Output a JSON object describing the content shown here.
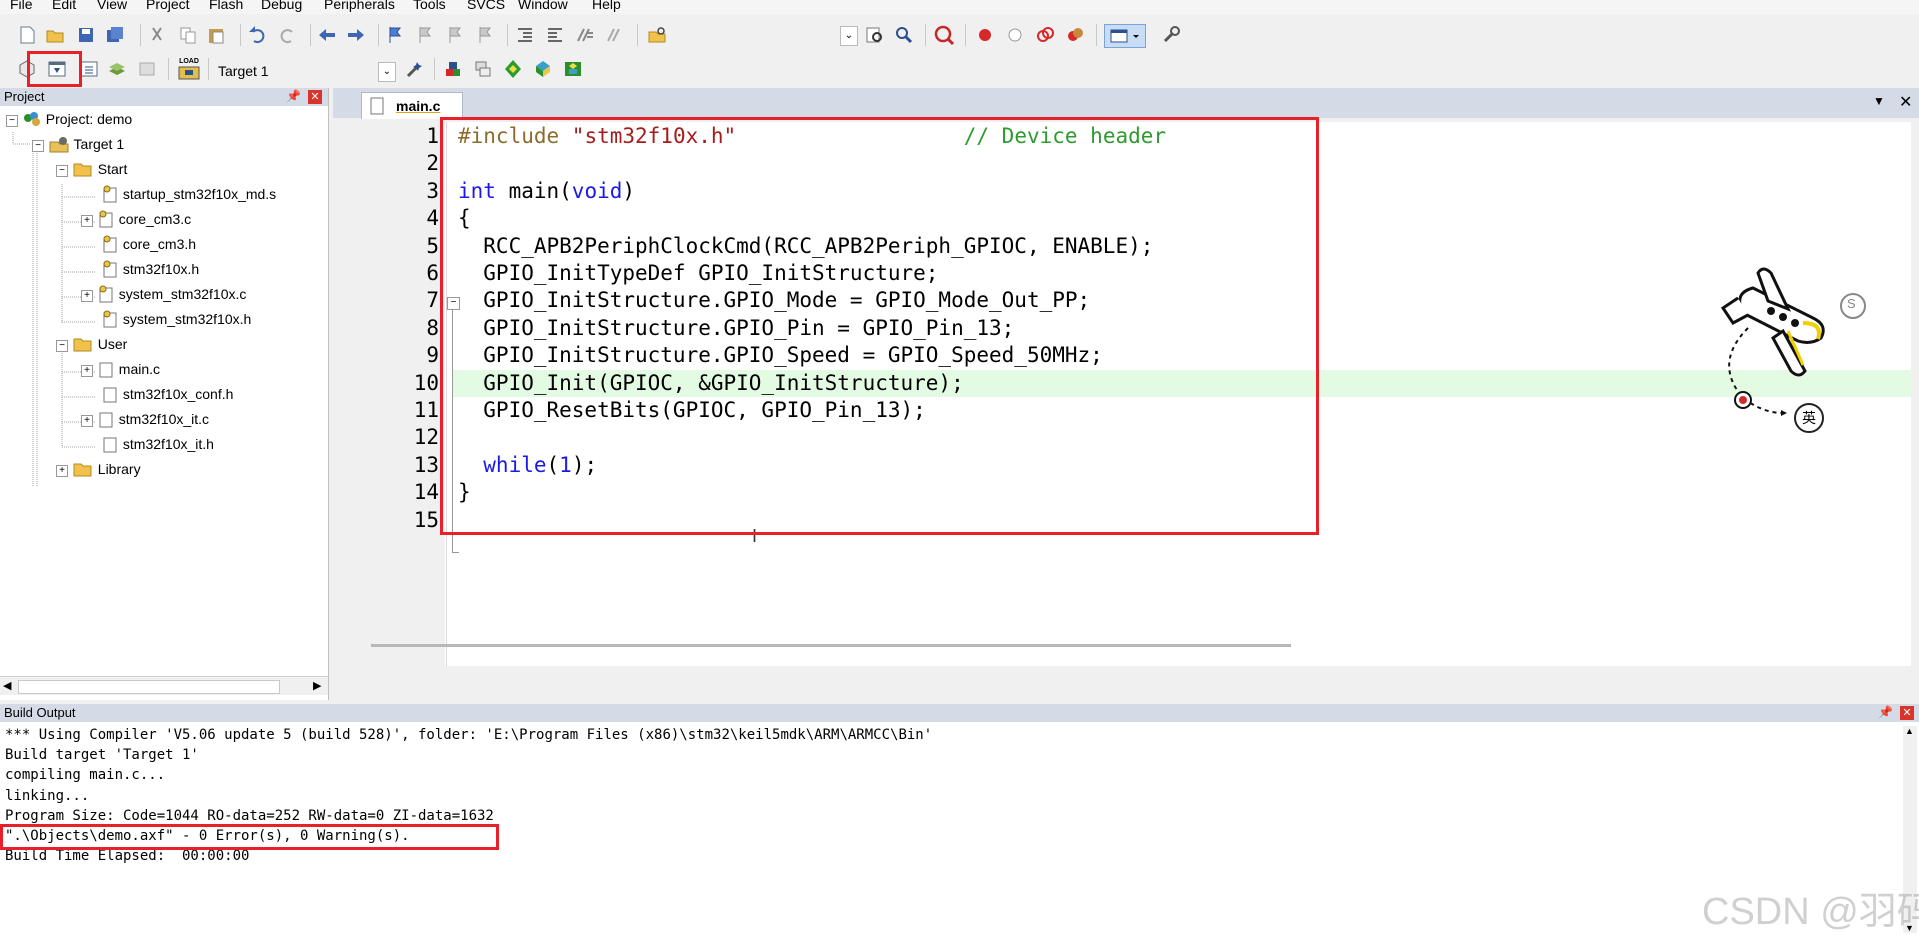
{
  "menu": [
    "File",
    "Edit",
    "View",
    "Project",
    "Flash",
    "Debug",
    "Peripherals",
    "Tools",
    "SVCS",
    "Window",
    "Help"
  ],
  "toolbar2": {
    "target_select": "Target 1",
    "load_label": "LOAD"
  },
  "project_panel": {
    "title": "Project",
    "tree": [
      {
        "label": "Project: demo",
        "kind": "project"
      },
      {
        "label": "Target 1",
        "kind": "target"
      },
      {
        "label": "Start",
        "kind": "folder"
      },
      {
        "label": "startup_stm32f10x_md.s",
        "kind": "file-special"
      },
      {
        "label": "core_cm3.c",
        "kind": "file-special"
      },
      {
        "label": "core_cm3.h",
        "kind": "file-special"
      },
      {
        "label": "stm32f10x.h",
        "kind": "file-special"
      },
      {
        "label": "system_stm32f10x.c",
        "kind": "file-special"
      },
      {
        "label": "system_stm32f10x.h",
        "kind": "file-special"
      },
      {
        "label": "User",
        "kind": "folder"
      },
      {
        "label": "main.c",
        "kind": "file"
      },
      {
        "label": "stm32f10x_conf.h",
        "kind": "file"
      },
      {
        "label": "stm32f10x_it.c",
        "kind": "file"
      },
      {
        "label": "stm32f10x_it.h",
        "kind": "file"
      },
      {
        "label": "Library",
        "kind": "folder"
      }
    ]
  },
  "editor": {
    "tab": "main.c",
    "lines": [
      {
        "n": "1",
        "pp": "#include",
        "str": " \"stm32f10x.h\"",
        "cm": "                  // Device header"
      },
      {
        "n": "2"
      },
      {
        "n": "3",
        "kw1": "int",
        "t1": " main(",
        "kw2": "void",
        "t2": ")"
      },
      {
        "n": "4",
        "t1": "{"
      },
      {
        "n": "5",
        "t1": "  RCC_APB2PeriphClockCmd(RCC_APB2Periph_GPIOC, ENABLE);"
      },
      {
        "n": "6",
        "t1": "  GPIO_InitTypeDef GPIO_InitStructure;"
      },
      {
        "n": "7",
        "t1": "  GPIO_InitStructure.GPIO_Mode = GPIO_Mode_Out_PP;"
      },
      {
        "n": "8",
        "t1": "  GPIO_InitStructure.GPIO_Pin = GPIO_Pin_13;"
      },
      {
        "n": "9",
        "t1": "  GPIO_InitStructure.GPIO_Speed = GPIO_Speed_50MHz;"
      },
      {
        "n": "10",
        "t1": "  GPIO_Init(GPIOC, &GPIO_InitStructure);"
      },
      {
        "n": "11",
        "t1": "  GPIO_ResetBits(GPIOC, GPIO_Pin_13);"
      },
      {
        "n": "12"
      },
      {
        "n": "13",
        "kw1": "  while",
        "t1": "(",
        "num": "1",
        "t2": ");"
      },
      {
        "n": "14",
        "t1": "}"
      },
      {
        "n": "15"
      }
    ],
    "highlight_line": "10"
  },
  "build_output": {
    "title": "Build Output",
    "lines": [
      "*** Using Compiler 'V5.06 update 5 (build 528)', folder: 'E:\\Program Files (x86)\\stm32\\keil5mdk\\ARM\\ARMCC\\Bin'",
      "Build target 'Target 1'",
      "compiling main.c...",
      "linking...",
      "Program Size: Code=1044 RO-data=252 RW-data=0 ZI-data=1632",
      "\".\\Objects\\demo.axf\" - 0 Error(s), 0 Warning(s).",
      "Build Time Elapsed:  00:00:00"
    ]
  },
  "ime_badge": "英",
  "watermark": "CSDN @羽码",
  "colors": {
    "annotation_red": "#e8202a",
    "highlight_green": "#e3fae3",
    "panel_title": "#d4dbe6"
  }
}
